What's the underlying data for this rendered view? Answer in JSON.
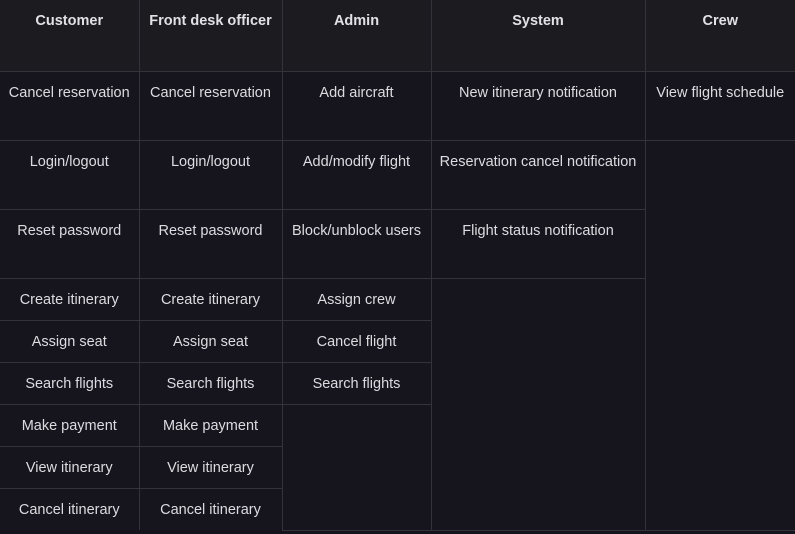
{
  "headers": [
    "Customer",
    "Front desk officer",
    "Admin",
    "System",
    "Crew"
  ],
  "customer": [
    "Cancel reservation",
    "Login/logout",
    "Reset password",
    "Create itinerary",
    "Assign seat",
    "Search flights",
    "Make payment",
    "View itinerary",
    "Cancel itinerary"
  ],
  "front_desk": [
    "Cancel reservation",
    "Login/logout",
    "Reset password",
    "Create itinerary",
    "Assign seat",
    "Search flights",
    "Make payment",
    "View itinerary",
    "Cancel itinerary"
  ],
  "admin": [
    "Add aircraft",
    "Add/modify flight",
    "Block/unblock users",
    "Assign crew",
    "Cancel flight",
    "Search flights"
  ],
  "system": [
    "New itinerary notification",
    "Reservation cancel notification",
    "Flight status notification"
  ],
  "crew": [
    "View flight schedule"
  ]
}
